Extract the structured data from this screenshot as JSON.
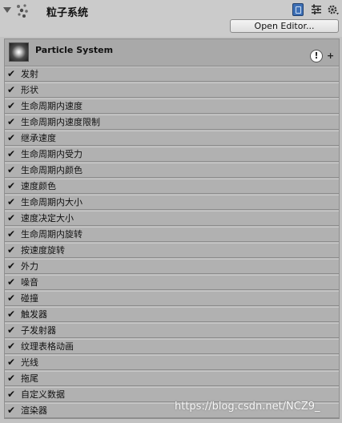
{
  "header": {
    "title": "粒子系统",
    "open_editor_label": "Open Editor...",
    "icons": [
      "fold-arrow-icon",
      "component-icon",
      "book-icon",
      "sliders-icon",
      "gear-icon"
    ]
  },
  "particle_system": {
    "name": "Particle System",
    "icons": [
      "particle-thumbnail-icon",
      "warning-icon",
      "plus-icon"
    ]
  },
  "modules": [
    {
      "label": "发射"
    },
    {
      "label": "形状"
    },
    {
      "label": "生命周期内速度"
    },
    {
      "label": "生命周期内速度限制"
    },
    {
      "label": "继承速度"
    },
    {
      "label": "生命周期内受力"
    },
    {
      "label": "生命周期内颜色"
    },
    {
      "label": "速度颜色"
    },
    {
      "label": "生命周期内大小"
    },
    {
      "label": "速度决定大小"
    },
    {
      "label": "生命周期内旋转"
    },
    {
      "label": "按速度旋转"
    },
    {
      "label": "外力"
    },
    {
      "label": "噪音"
    },
    {
      "label": "碰撞"
    },
    {
      "label": "触发器"
    },
    {
      "label": "子发射器"
    },
    {
      "label": "纹理表格动画"
    },
    {
      "label": "光线"
    },
    {
      "label": "拖尾"
    },
    {
      "label": "自定义数据"
    },
    {
      "label": "渲染器"
    }
  ],
  "check_mark": "✔",
  "watermark": "https://blog.csdn.net/NCZ9_"
}
